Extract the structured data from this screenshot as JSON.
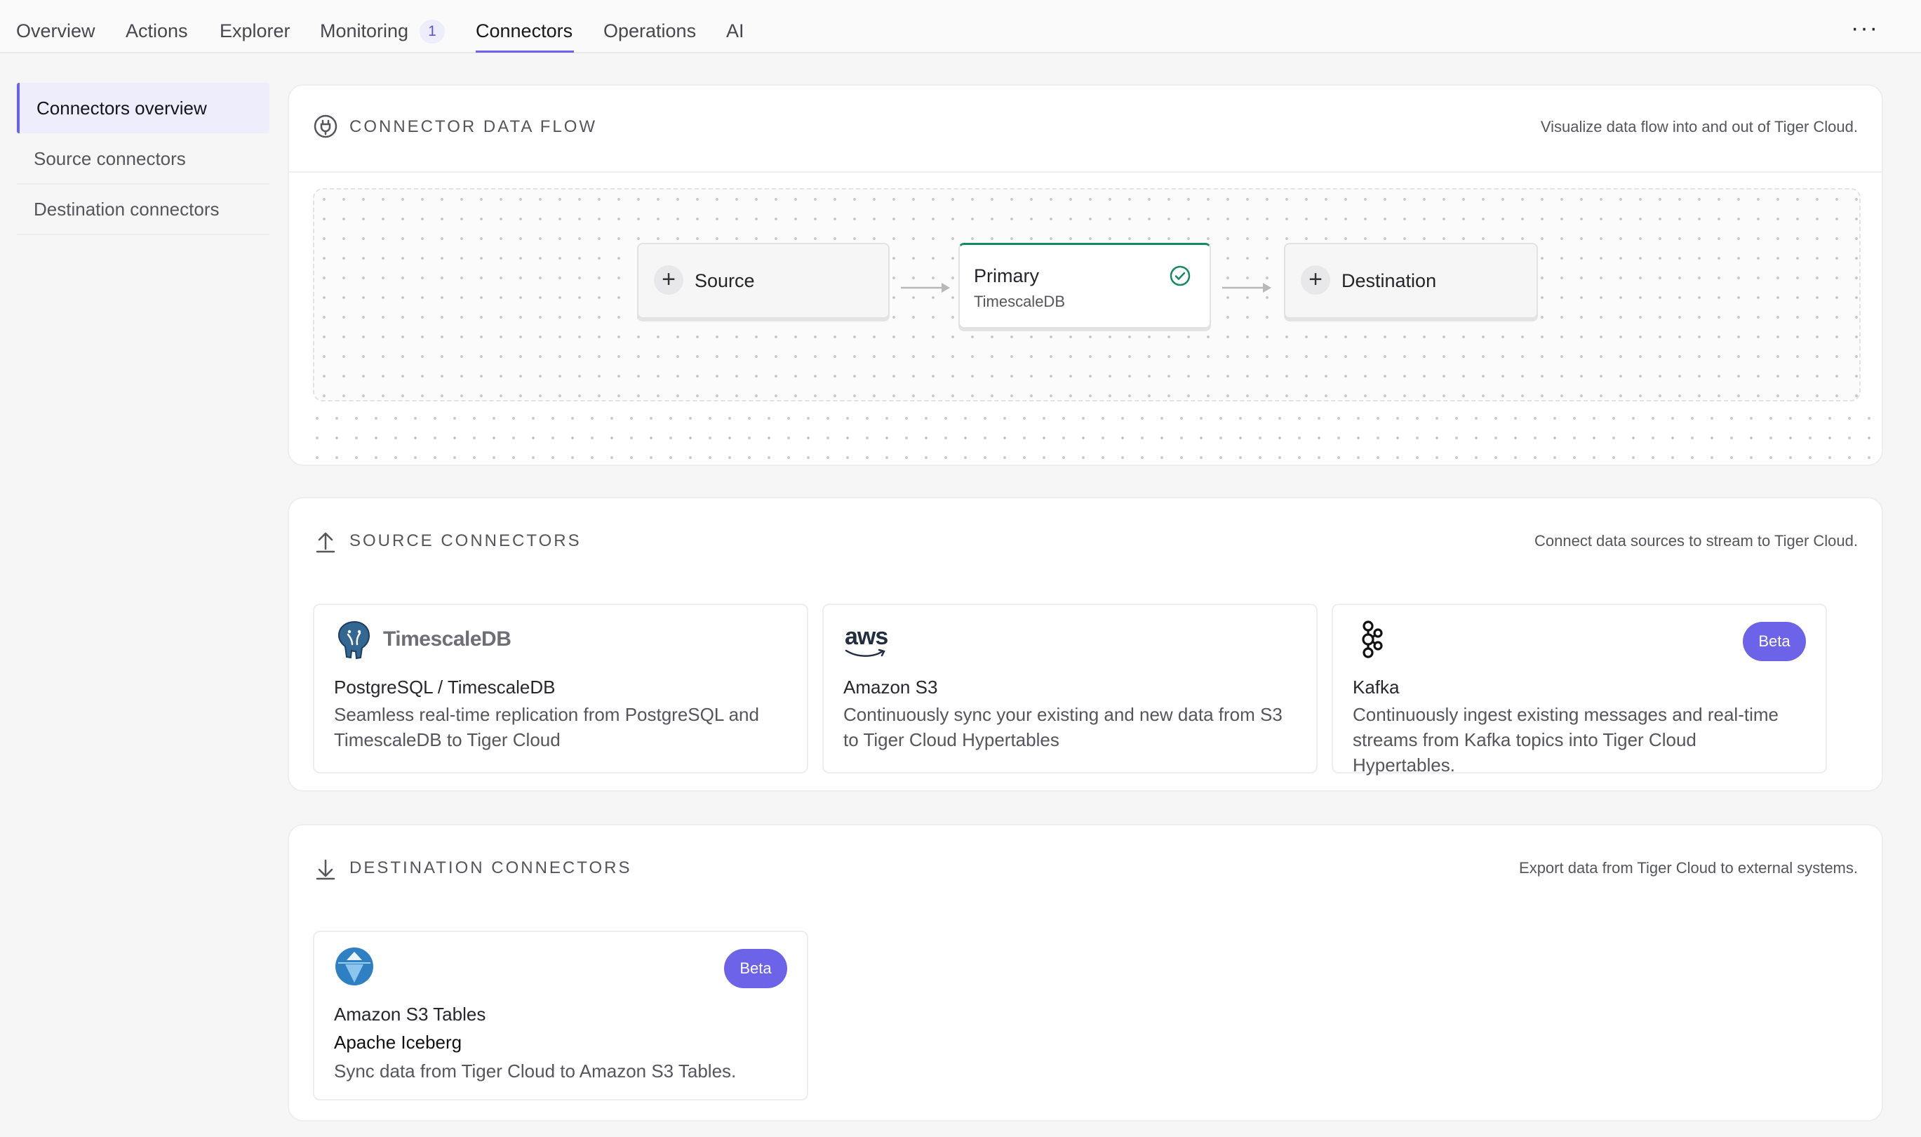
{
  "topnav": {
    "tabs": [
      {
        "label": "Overview"
      },
      {
        "label": "Actions"
      },
      {
        "label": "Explorer"
      },
      {
        "label": "Monitoring",
        "badge": "1"
      },
      {
        "label": "Connectors"
      },
      {
        "label": "Operations"
      },
      {
        "label": "AI"
      }
    ],
    "active_tab": "Connectors",
    "more_label": "···"
  },
  "sidebar": {
    "items": [
      {
        "label": "Connectors overview",
        "active": true
      },
      {
        "label": "Source connectors"
      },
      {
        "label": "Destination connectors"
      }
    ]
  },
  "flow": {
    "title": "CONNECTOR DATA FLOW",
    "description": "Visualize data flow into and out of Tiger Cloud.",
    "source_label": "Source",
    "primary_title": "Primary",
    "primary_sub": "TimescaleDB",
    "destination_label": "Destination",
    "plus_glyph": "+"
  },
  "source": {
    "title": "SOURCE CONNECTORS",
    "description": "Connect data sources to stream to Tiger Cloud.",
    "cards": [
      {
        "logo": "elephant-timescaledb-logo",
        "logo_word": "TimescaleDB",
        "title": "PostgreSQL / TimescaleDB",
        "desc": "Seamless real-time replication from PostgreSQL and TimescaleDB to Tiger Cloud"
      },
      {
        "logo": "aws-logo",
        "logo_word": "aws",
        "title": "Amazon S3",
        "desc": "Continuously sync your existing and new data from S3 to Tiger Cloud Hypertables"
      },
      {
        "logo": "kafka-logo",
        "title": "Kafka",
        "badge": "Beta",
        "desc": "Continuously ingest existing messages and real-time streams from Kafka topics into Tiger Cloud Hypertables."
      }
    ]
  },
  "destination": {
    "title": "DESTINATION CONNECTORS",
    "description": "Export data from Tiger Cloud to external systems.",
    "cards": [
      {
        "logo": "iceberg-logo",
        "title": "Amazon S3 Tables",
        "subtitle": "Apache Iceberg",
        "badge": "Beta",
        "desc": "Sync data from Tiger Cloud to Amazon S3 Tables."
      }
    ]
  },
  "colors": {
    "accent": "#6c63e8",
    "success": "#138a63",
    "background": "#f6f6f6"
  }
}
